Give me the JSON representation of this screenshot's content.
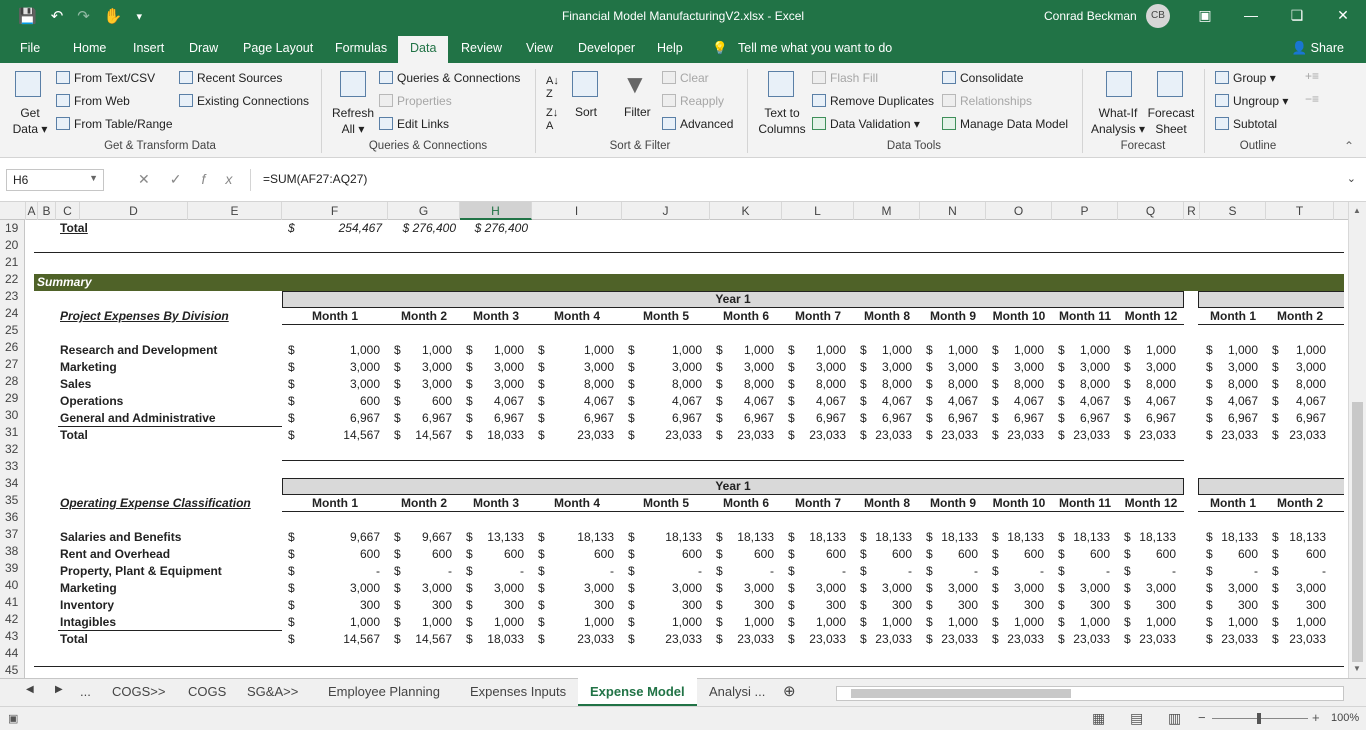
{
  "app": {
    "title": "Financial Model ManufacturingV2.xlsx  -  Excel",
    "user": "Conrad Beckman",
    "initials": "CB",
    "share": "Share"
  },
  "ribbon_tabs": [
    "File",
    "Home",
    "Insert",
    "Draw",
    "Page Layout",
    "Formulas",
    "Data",
    "Review",
    "View",
    "Developer",
    "Help"
  ],
  "tell_me": "Tell me what you want to do",
  "ribbon": {
    "get_data": [
      "Get",
      "Data"
    ],
    "from_text": "From Text/CSV",
    "from_web": "From Web",
    "from_table": "From Table/Range",
    "recent_sources": "Recent Sources",
    "existing_connections": "Existing Connections",
    "group_get": "Get & Transform Data",
    "refresh": [
      "Refresh",
      "All"
    ],
    "queries": "Queries & Connections",
    "properties": "Properties",
    "edit_links": "Edit Links",
    "group_queries": "Queries & Connections",
    "sort": "Sort",
    "filter": "Filter",
    "clear": "Clear",
    "reapply": "Reapply",
    "advanced": "Advanced",
    "group_sort": "Sort & Filter",
    "text_to_columns": [
      "Text to",
      "Columns"
    ],
    "flash_fill": "Flash Fill",
    "remove_duplicates": "Remove Duplicates",
    "data_validation": "Data Validation",
    "consolidate": "Consolidate",
    "relationships": "Relationships",
    "manage_model": "Manage Data Model",
    "group_tools": "Data Tools",
    "what_if": [
      "What-If",
      "Analysis"
    ],
    "forecast_sheet": [
      "Forecast",
      "Sheet"
    ],
    "group_forecast": "Forecast",
    "group_btn": "Group",
    "ungroup": "Ungroup",
    "subtotal": "Subtotal",
    "group_outline": "Outline"
  },
  "formula_bar": {
    "name_box": "H6",
    "formula": "=SUM(AF27:AQ27)"
  },
  "columns": [
    "A",
    "B",
    "C",
    "D",
    "E",
    "F",
    "G",
    "H",
    "I",
    "J",
    "K",
    "L",
    "M",
    "N",
    "O",
    "P",
    "Q",
    "R",
    "S",
    "T"
  ],
  "rows": [
    "19",
    "20",
    "21",
    "22",
    "23",
    "24",
    "25",
    "26",
    "27",
    "28",
    "29",
    "30",
    "31",
    "32",
    "33",
    "34",
    "35",
    "36",
    "37",
    "38",
    "39",
    "40",
    "41",
    "42",
    "43",
    "44",
    "45"
  ],
  "sheet": {
    "top_total": {
      "label": "Total",
      "cur": "$",
      "f": "254,467",
      "g": "$ 276,400",
      "h": "$ 276,400"
    },
    "summary": "Summary",
    "year1": "Year 1",
    "months": [
      "Month 1",
      "Month 2",
      "Month 3",
      "Month 4",
      "Month 5",
      "Month 6",
      "Month 7",
      "Month 8",
      "Month 9",
      "Month 10",
      "Month 11",
      "Month 12"
    ],
    "next_months": [
      "Month 1",
      "Month 2"
    ],
    "section1": {
      "title": "Project Expenses By Division",
      "rows": [
        {
          "label": "Research and Development",
          "values": [
            "1,000",
            "1,000",
            "1,000",
            "1,000",
            "1,000",
            "1,000",
            "1,000",
            "1,000",
            "1,000",
            "1,000",
            "1,000",
            "1,000"
          ],
          "next": [
            "1,000",
            "1,000"
          ]
        },
        {
          "label": "Marketing",
          "values": [
            "3,000",
            "3,000",
            "3,000",
            "3,000",
            "3,000",
            "3,000",
            "3,000",
            "3,000",
            "3,000",
            "3,000",
            "3,000",
            "3,000"
          ],
          "next": [
            "3,000",
            "3,000"
          ]
        },
        {
          "label": "Sales",
          "values": [
            "3,000",
            "3,000",
            "3,000",
            "8,000",
            "8,000",
            "8,000",
            "8,000",
            "8,000",
            "8,000",
            "8,000",
            "8,000",
            "8,000"
          ],
          "next": [
            "8,000",
            "8,000"
          ]
        },
        {
          "label": "Operations",
          "values": [
            "600",
            "600",
            "4,067",
            "4,067",
            "4,067",
            "4,067",
            "4,067",
            "4,067",
            "4,067",
            "4,067",
            "4,067",
            "4,067"
          ],
          "next": [
            "4,067",
            "4,067"
          ]
        },
        {
          "label": "General and Administrative",
          "values": [
            "6,967",
            "6,967",
            "6,967",
            "6,967",
            "6,967",
            "6,967",
            "6,967",
            "6,967",
            "6,967",
            "6,967",
            "6,967",
            "6,967"
          ],
          "next": [
            "6,967",
            "6,967"
          ]
        },
        {
          "label": "Total",
          "values": [
            "14,567",
            "14,567",
            "18,033",
            "23,033",
            "23,033",
            "23,033",
            "23,033",
            "23,033",
            "23,033",
            "23,033",
            "23,033",
            "23,033"
          ],
          "next": [
            "23,033",
            "23,033"
          ]
        }
      ]
    },
    "section2": {
      "title": "Operating Expense Classification",
      "rows": [
        {
          "label": "Salaries and Benefits",
          "values": [
            "9,667",
            "9,667",
            "13,133",
            "18,133",
            "18,133",
            "18,133",
            "18,133",
            "18,133",
            "18,133",
            "18,133",
            "18,133",
            "18,133"
          ],
          "next": [
            "18,133",
            "18,133"
          ]
        },
        {
          "label": "Rent and Overhead",
          "values": [
            "600",
            "600",
            "600",
            "600",
            "600",
            "600",
            "600",
            "600",
            "600",
            "600",
            "600",
            "600"
          ],
          "next": [
            "600",
            "600"
          ]
        },
        {
          "label": "Property, Plant & Equipment",
          "values": [
            "-",
            "-",
            "-",
            "-",
            "-",
            "-",
            "-",
            "-",
            "-",
            "-",
            "-",
            "-"
          ],
          "next": [
            "-",
            "-"
          ]
        },
        {
          "label": "Marketing",
          "values": [
            "3,000",
            "3,000",
            "3,000",
            "3,000",
            "3,000",
            "3,000",
            "3,000",
            "3,000",
            "3,000",
            "3,000",
            "3,000",
            "3,000"
          ],
          "next": [
            "3,000",
            "3,000"
          ]
        },
        {
          "label": "Inventory",
          "values": [
            "300",
            "300",
            "300",
            "300",
            "300",
            "300",
            "300",
            "300",
            "300",
            "300",
            "300",
            "300"
          ],
          "next": [
            "300",
            "300"
          ]
        },
        {
          "label": "Intagibles",
          "values": [
            "1,000",
            "1,000",
            "1,000",
            "1,000",
            "1,000",
            "1,000",
            "1,000",
            "1,000",
            "1,000",
            "1,000",
            "1,000",
            "1,000"
          ],
          "next": [
            "1,000",
            "1,000"
          ]
        },
        {
          "label": "Total",
          "values": [
            "14,567",
            "14,567",
            "18,033",
            "23,033",
            "23,033",
            "23,033",
            "23,033",
            "23,033",
            "23,033",
            "23,033",
            "23,033",
            "23,033"
          ],
          "next": [
            "23,033",
            "23,033"
          ]
        }
      ]
    }
  },
  "sheet_tabs": [
    "...",
    "COGS>>",
    "COGS",
    "SG&A>>",
    "Employee Planning",
    "Expenses Inputs",
    "Expense Model",
    "Analysi  ..."
  ],
  "active_sheet": "Expense Model",
  "zoom": "100%",
  "colors": {
    "excel_green": "#217346",
    "summary_band": "#4f6228",
    "year_band": "#d9d9d9"
  }
}
